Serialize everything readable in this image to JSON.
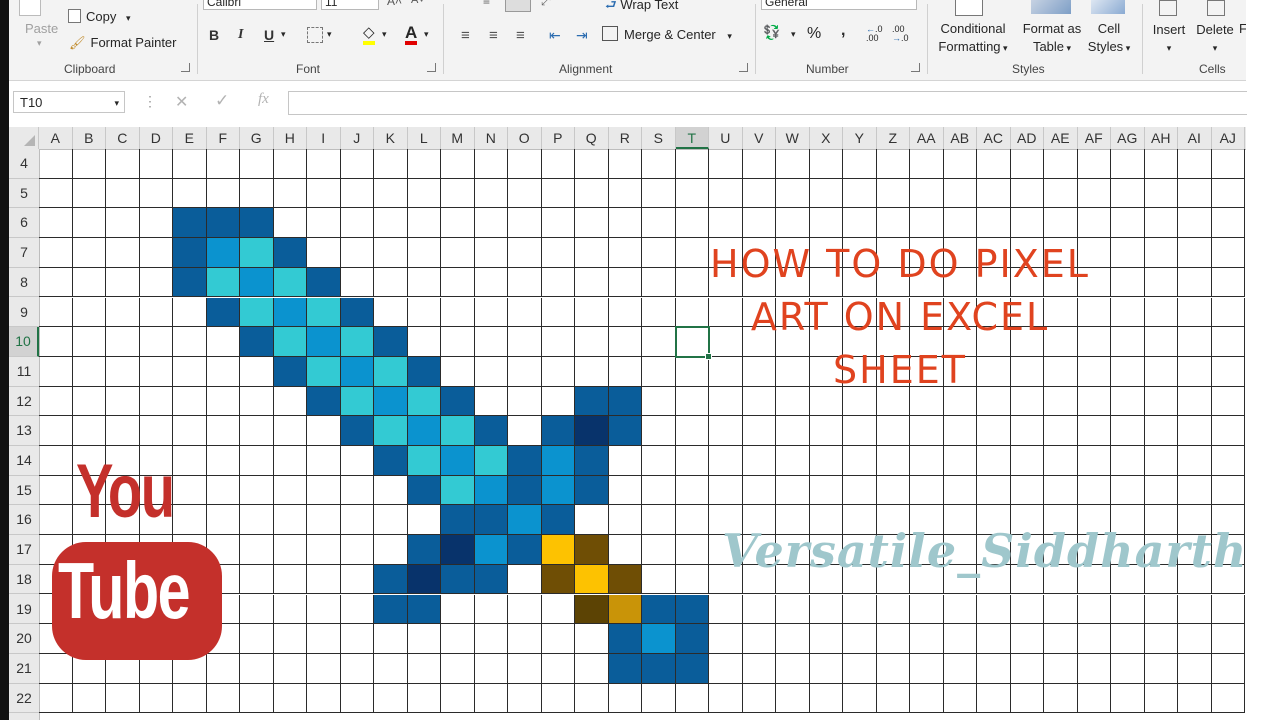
{
  "ribbon": {
    "clipboard": {
      "paste_label": "Paste",
      "copy_label": "Copy",
      "format_painter_label": "Format Painter",
      "group_label": "Clipboard"
    },
    "font": {
      "font_name": "Calibri",
      "font_size": "11",
      "bold": "B",
      "italic": "I",
      "underline": "U",
      "group_label": "Font"
    },
    "alignment": {
      "wrap_text_label": "Wrap Text",
      "merge_center_label": "Merge & Center",
      "group_label": "Alignment"
    },
    "number": {
      "format_value": "General",
      "percent": "%",
      "comma": ",",
      "inc_decimal": "←.0 .00",
      "dec_decimal": ".00 →.0",
      "group_label": "Number"
    },
    "styles": {
      "conditional_formatting_label": "Conditional Formatting",
      "cf_line1": "Conditional",
      "cf_line2": "Formatting",
      "format_table_line1": "Format as",
      "format_table_line2": "Table",
      "cell_styles_line1": "Cell",
      "cell_styles_line2": "Styles",
      "group_label": "Styles"
    },
    "cells": {
      "insert_label": "Insert",
      "delete_label": "Delete",
      "format_label": "F",
      "group_label": "Cells"
    }
  },
  "formula_bar": {
    "name_box": "T10",
    "formula_value": ""
  },
  "sheet": {
    "columns": [
      "A",
      "B",
      "C",
      "D",
      "E",
      "F",
      "G",
      "H",
      "I",
      "J",
      "K",
      "L",
      "M",
      "N",
      "O",
      "P",
      "Q",
      "R",
      "S",
      "T",
      "U",
      "V",
      "W",
      "X",
      "Y",
      "Z",
      "AA",
      "AB",
      "AC",
      "AD",
      "AE",
      "AF",
      "AG",
      "AH",
      "AI",
      "AJ"
    ],
    "rows": [
      4,
      5,
      6,
      7,
      8,
      9,
      10,
      11,
      12,
      13,
      14,
      15,
      16,
      17,
      18,
      19,
      20,
      21,
      22
    ],
    "selected_column": "T",
    "selected_row": 10,
    "active_cell": "T10",
    "palette": {
      "M": "#0a5d9a",
      "L": "#0b93cf",
      "C": "#33cad3",
      "D": "#08336b",
      "G": "#fdc201",
      "B": "#6f4e05",
      "K": "#5c4304",
      "Y": "#c99408"
    },
    "pixel_art": [
      "E6:M",
      "F6:M",
      "G6:M",
      "E7:M",
      "F7:L",
      "G7:C",
      "H7:M",
      "E8:M",
      "F8:C",
      "G8:L",
      "H8:C",
      "I8:M",
      "F9:M",
      "G9:C",
      "H9:L",
      "I9:C",
      "J9:M",
      "G10:M",
      "H10:C",
      "I10:L",
      "J10:C",
      "K10:M",
      "H11:M",
      "I11:C",
      "J11:L",
      "K11:C",
      "L11:M",
      "I12:M",
      "J12:C",
      "K12:L",
      "L12:C",
      "M12:M",
      "Q12:M",
      "R12:M",
      "J13:M",
      "K13:C",
      "L13:L",
      "M13:C",
      "N13:M",
      "P13:M",
      "Q13:D",
      "R13:M",
      "K14:M",
      "L14:C",
      "M14:L",
      "N14:C",
      "O14:M",
      "P14:L",
      "Q14:M",
      "L15:M",
      "M15:C",
      "N15:L",
      "O15:M",
      "P15:L",
      "Q15:M",
      "M16:M",
      "N16:M",
      "O16:L",
      "P16:M",
      "L17:M",
      "M17:D",
      "N17:L",
      "O17:M",
      "P17:G",
      "Q17:B",
      "K18:M",
      "L18:D",
      "M18:M",
      "N18:M",
      "P18:B",
      "Q18:G",
      "R18:B",
      "K19:M",
      "L19:M",
      "Q19:K",
      "R19:Y",
      "S19:M",
      "T19:M",
      "R20:M",
      "S20:L",
      "T20:M",
      "R21:M",
      "S21:M",
      "T21:M"
    ]
  },
  "overlay": {
    "headline_line1": "HOW TO DO PIXEL",
    "headline_line2": "ART ON EXCEL",
    "headline_line3": "SHEET",
    "watermark": "Versatile_Siddharth",
    "logo_you": "You",
    "logo_tube": "Tube"
  }
}
